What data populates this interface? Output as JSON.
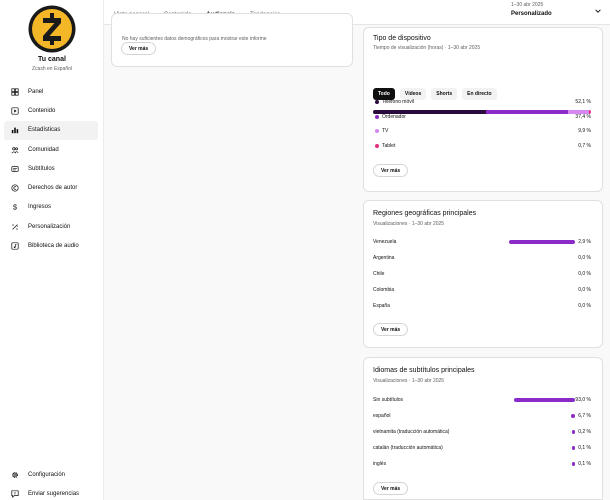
{
  "channel": {
    "name": "Tu canal",
    "subtitle": "Zcash en Español"
  },
  "sidebar": {
    "items": [
      {
        "label": "Panel",
        "icon": "dashboard-icon"
      },
      {
        "label": "Contenido",
        "icon": "video-icon"
      },
      {
        "label": "Estadísticas",
        "icon": "analytics-icon",
        "active": true
      },
      {
        "label": "Comunidad",
        "icon": "community-icon"
      },
      {
        "label": "Subtítulos",
        "icon": "subtitles-icon"
      },
      {
        "label": "Derechos de autor",
        "icon": "copyright-icon"
      },
      {
        "label": "Ingresos",
        "icon": "dollar-icon"
      },
      {
        "label": "Personalización",
        "icon": "customization-icon"
      },
      {
        "label": "Biblioteca de audio",
        "icon": "audio-library-icon"
      }
    ],
    "bottom": [
      {
        "label": "Configuración",
        "icon": "gear-icon"
      },
      {
        "label": "Enviar sugerencias",
        "icon": "feedback-icon"
      }
    ]
  },
  "header": {
    "tabs": [
      {
        "label": "Vista general"
      },
      {
        "label": "Contenido"
      },
      {
        "label": "Audiencia",
        "active": true
      },
      {
        "label": "Tendencias"
      }
    ],
    "date_range": "1–30 abr 2025",
    "date_preset": "Personalizado"
  },
  "left_card": {
    "note": "No hay suficientes datos demográficos para mostrar este informe",
    "button": "Ver más"
  },
  "device_card": {
    "title": "Tipo de dispositivo",
    "subtitle": "Tiempo de visualización (horas) · 1–30 abr 2025",
    "chips": [
      {
        "label": "Todo",
        "active": true
      },
      {
        "label": "Vídeos"
      },
      {
        "label": "Shorts"
      },
      {
        "label": "En directo"
      }
    ],
    "rows": [
      {
        "label": "Teléfono móvil",
        "value": "52,1 %",
        "share": 52.1,
        "color": "#2a0a3c"
      },
      {
        "label": "Ordenador",
        "value": "37,4 %",
        "share": 37.4,
        "color": "#8a2bc8"
      },
      {
        "label": "TV",
        "value": "9,9 %",
        "share": 9.9,
        "color": "#d488f0"
      },
      {
        "label": "Tablet",
        "value": "0,7 %",
        "share": 0.7,
        "color": "#e0307f"
      }
    ],
    "button": "Ver más"
  },
  "geo_card": {
    "title": "Regiones geográficas principales",
    "subtitle": "Visualizaciones · 1–30 abr 2025",
    "rows": [
      {
        "label": "Venezuela",
        "value": "2,9 %",
        "share": 2.9
      },
      {
        "label": "Argentina",
        "value": "0,0 %",
        "share": 0
      },
      {
        "label": "Chile",
        "value": "0,0 %",
        "share": 0
      },
      {
        "label": "Colombia",
        "value": "0,0 %",
        "share": 0
      },
      {
        "label": "España",
        "value": "0,0 %",
        "share": 0
      }
    ],
    "button": "Ver más"
  },
  "lang_card": {
    "title": "Idiomas de subtítulos principales",
    "subtitle": "Visualizaciones · 1–30 abr 2025",
    "rows": [
      {
        "label": "Sin subtítulos",
        "value": "93,0 %",
        "share": 93.0
      },
      {
        "label": "español",
        "value": "6,7 %",
        "share": 6.7
      },
      {
        "label": "vietnamita (traducción automática)",
        "value": "0,2 %",
        "share": 0.2
      },
      {
        "label": "catalán (traducción automática)",
        "value": "0,1 %",
        "share": 0.1
      },
      {
        "label": "inglés",
        "value": "0,1 %",
        "share": 0.1
      }
    ],
    "button": "Ver más"
  },
  "colors": {
    "accent": "#8a2bc8",
    "logo": "#f4b728"
  }
}
